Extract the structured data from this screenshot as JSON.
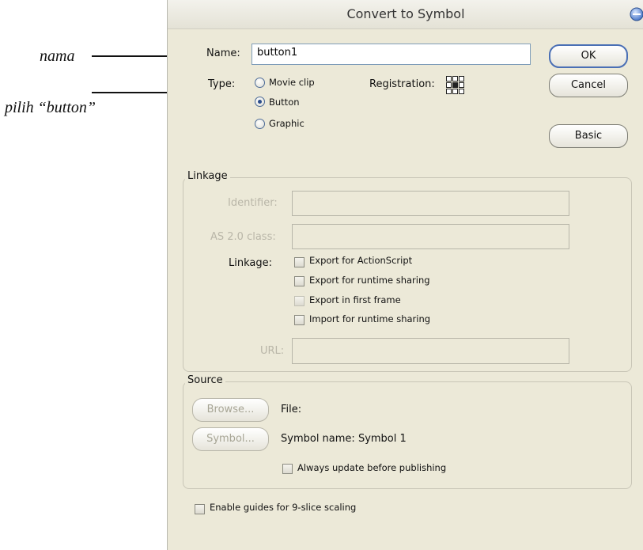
{
  "annotations": {
    "name_note": "nama",
    "type_note": "pilih “button”"
  },
  "dialog": {
    "title": "Convert to Symbol",
    "name_label": "Name:",
    "name_value": "button1",
    "type_label": "Type:",
    "type_options": [
      "Movie clip",
      "Button",
      "Graphic"
    ],
    "type_selected": "Button",
    "registration_label": "Registration:",
    "ok_label": "OK",
    "cancel_label": "Cancel",
    "basic_label": "Basic"
  },
  "linkage": {
    "group_title": "Linkage",
    "identifier_label": "Identifier:",
    "as_class_label": "AS 2.0 class:",
    "linkage_label": "Linkage:",
    "checkboxes": [
      "Export for ActionScript",
      "Export for runtime sharing",
      "Export in first frame",
      "Import for runtime sharing"
    ],
    "url_label": "URL:"
  },
  "source": {
    "group_title": "Source",
    "browse_label": "Browse...",
    "file_label": "File:",
    "symbol_button_label": "Symbol...",
    "symbol_name_text": "Symbol name: Symbol 1",
    "always_update_label": "Always update before publishing"
  },
  "footer": {
    "nine_slice_label": "Enable guides for 9-slice scaling"
  },
  "colors": {
    "dialog_bg": "#ece9d8",
    "accent": "#4a6fb5"
  },
  "icons": [
    "close-circle-icon",
    "arrow-right-icon",
    "registration-grid-icon"
  ]
}
